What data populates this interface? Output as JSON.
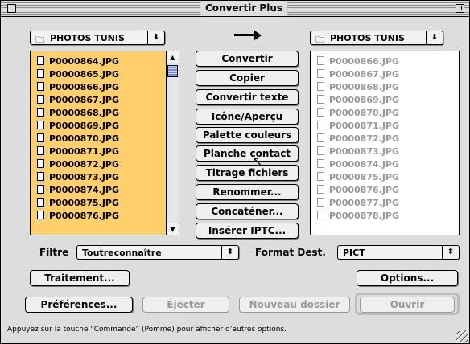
{
  "window": {
    "title": "Convertir Plus"
  },
  "source": {
    "folder": "PHOTOS TUNIS",
    "files": [
      "P0000864.JPG",
      "P0000865.JPG",
      "P0000866.JPG",
      "P0000867.JPG",
      "P0000868.JPG",
      "P0000869.JPG",
      "P0000870.JPG",
      "P0000871.JPG",
      "P0000872.JPG",
      "P0000873.JPG",
      "P0000874.JPG",
      "P0000875.JPG",
      "P0000876.JPG"
    ]
  },
  "destination": {
    "folder": "PHOTOS TUNIS",
    "files": [
      "P0000866.JPG",
      "P0000867.JPG",
      "P0000868.JPG",
      "P0000869.JPG",
      "P0000870.JPG",
      "P0000871.JPG",
      "P0000872.JPG",
      "P0000873.JPG",
      "P0000874.JPG",
      "P0000875.JPG",
      "P0000876.JPG",
      "P0000877.JPG",
      "P0000878.JPG"
    ]
  },
  "actions": [
    "Convertir",
    "Copier",
    "Convertir texte",
    "Icône/Aperçu",
    "Palette couleurs",
    "Planche contact",
    "Titrage fichiers",
    "Renommer...",
    "Concaténer...",
    "Insérer IPTC..."
  ],
  "filter": {
    "label": "Filtre",
    "value": "Toutreconnaître"
  },
  "format": {
    "label": "Format Dest.",
    "value": "PICT"
  },
  "buttons": {
    "traitement": "Traitement...",
    "options": "Options...",
    "preferences": "Préférences...",
    "ejecter": "Éjecter",
    "nouveau_dossier": "Nouveau dossier",
    "ouvrir": "Ouvrir"
  },
  "status": "Appuyez sur la touche “Commande” (Pomme) pour afficher d’autres options.",
  "icons": {
    "folder": "folder-icon",
    "document": "document-icon",
    "arrow": "right-arrow-icon"
  },
  "colors": {
    "source_list_bg": "#ffcf6b",
    "scroll_thumb": "#8fa7ff",
    "window_bg": "#dddddd"
  }
}
